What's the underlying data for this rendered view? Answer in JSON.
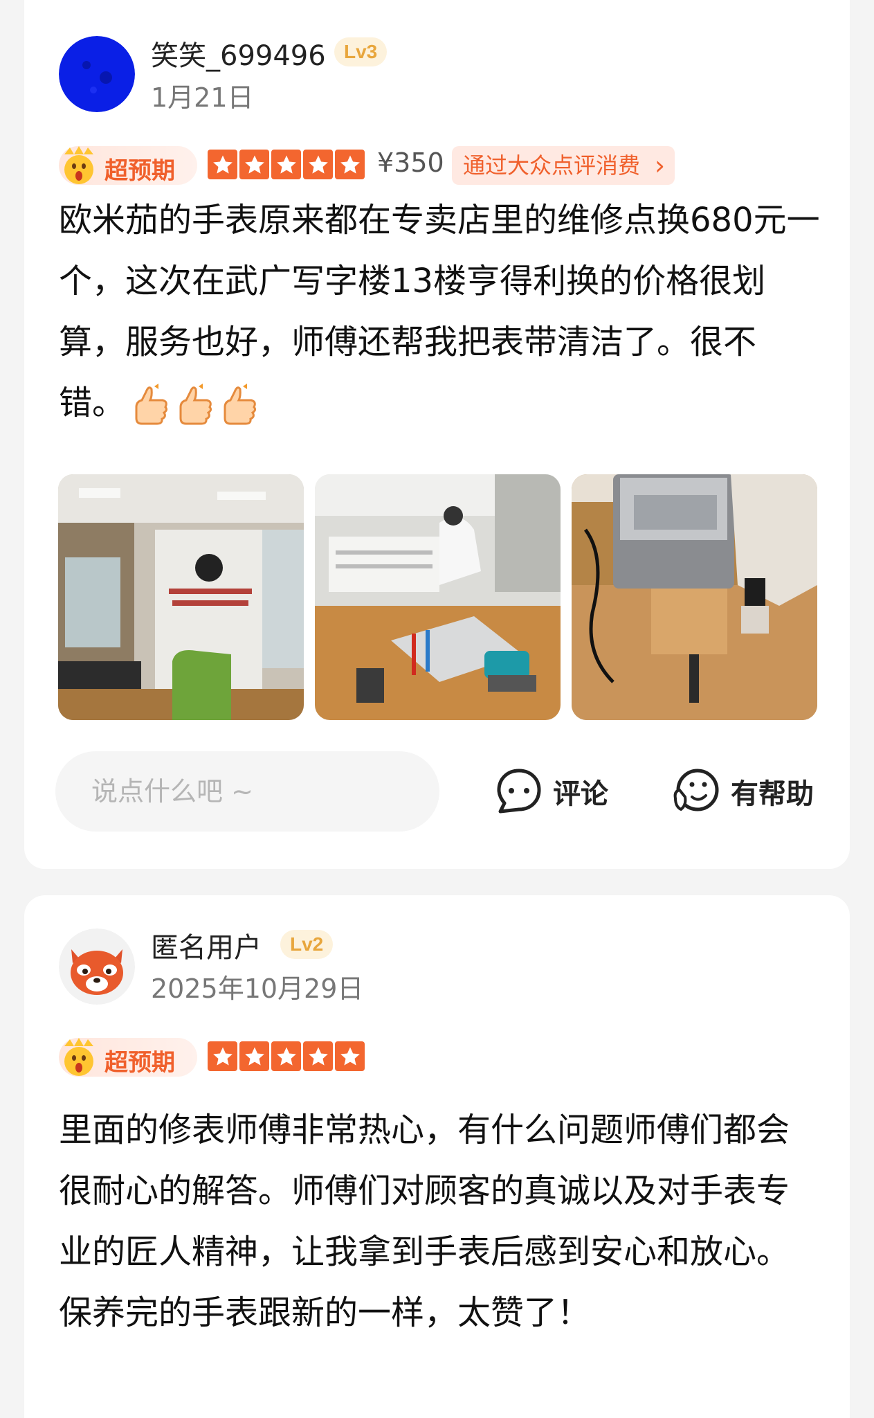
{
  "reviews": [
    {
      "username": "笑笑_699496",
      "level": "Lv3",
      "date": "1月21日",
      "tag": "超预期",
      "rating": 5,
      "price": "¥350",
      "source": "通过大众点评消费",
      "text": "欧米茄的手表原来都在专卖店里的维修点换680元一个，这次在武广写字楼13楼亨得利换的价格很划算，服务也好，师傅还帮我把表带清洁了。很不错。",
      "emoji_count": 3,
      "avatar_color": "#0a1fe6",
      "photos": [
        {
          "name": "store-entrance-photo"
        },
        {
          "name": "repair-workbench-photo"
        },
        {
          "name": "cleaning-machine-photo"
        }
      ]
    },
    {
      "username": "匿名用户",
      "level": "Lv2",
      "date": "2025年10月29日",
      "tag": "超预期",
      "rating": 5,
      "text": "里面的修表师傅非常热心，有什么问题师傅们都会很耐心的解答。师傅们对顾客的真诚以及对手表专业的匠人精神，让我拿到手表后感到安心和放心。保养完的手表跟新的一样，太赞了！"
    }
  ],
  "actions": {
    "comment_placeholder": "说点什么吧 ~",
    "comment_label": "评论",
    "helpful_label": "有帮助"
  },
  "colors": {
    "accent": "#f3662f",
    "level_text": "#e8a63c"
  }
}
